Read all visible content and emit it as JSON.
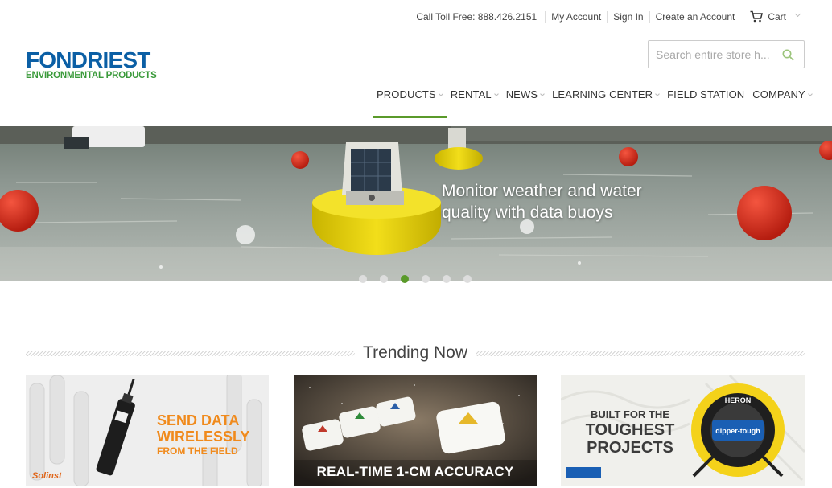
{
  "header": {
    "phone": "Call Toll Free: 888.426.2151",
    "my_account": "My Account",
    "sign_in": "Sign In",
    "create_account": "Create an Account",
    "cart": "Cart"
  },
  "logo": {
    "main": "FONDRIEST",
    "sub": "ENVIRONMENTAL PRODUCTS"
  },
  "search": {
    "placeholder": "Search entire store h..."
  },
  "nav": {
    "items": [
      {
        "label": "PRODUCTS"
      },
      {
        "label": "RENTAL"
      },
      {
        "label": "NEWS"
      },
      {
        "label": "LEARNING CENTER"
      },
      {
        "label": "FIELD STATION"
      },
      {
        "label": "COMPANY"
      }
    ],
    "active_index": 0
  },
  "hero": {
    "caption_line1": "Monitor weather and water",
    "caption_line2": "quality with data buoys",
    "slide_count": 6,
    "active_slide": 3
  },
  "trending": {
    "title": "Trending Now",
    "tiles": [
      {
        "text_line1": "SEND DATA",
        "text_line2": "WIRELESSLY",
        "text_line3": "FROM THE FIELD",
        "brand": "Solinst"
      },
      {
        "text": "REAL-TIME 1-CM ACCURACY"
      },
      {
        "text_line1": "BUILT FOR THE",
        "text_line2": "TOUGHEST",
        "text_line3": "PROJECTS",
        "brand": "HERON",
        "product": "dipper-tough"
      }
    ]
  },
  "colors": {
    "accent_green": "#5a9a2a",
    "logo_blue": "#0b5fa5",
    "logo_green": "#3a9a3a",
    "tile_orange": "#f08a1c"
  }
}
